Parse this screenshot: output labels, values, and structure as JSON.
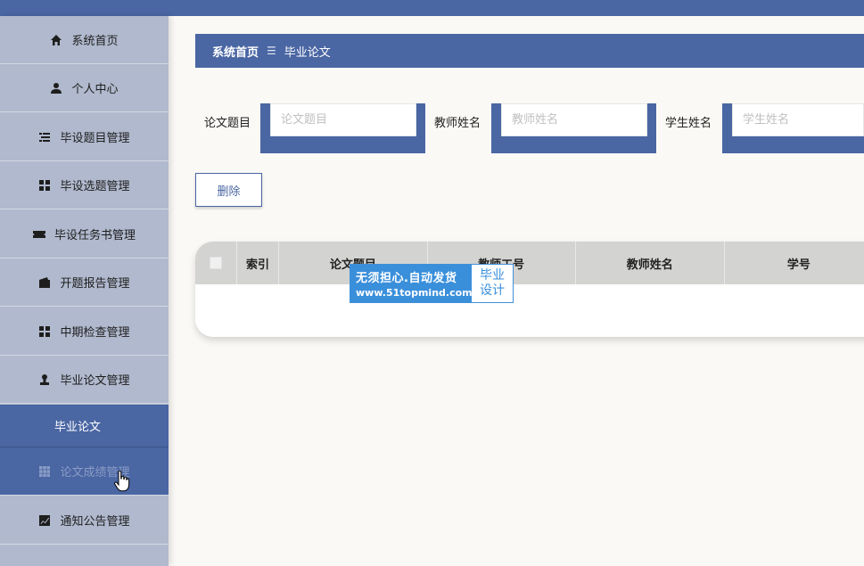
{
  "sidebar": {
    "items": [
      {
        "label": "系统首页",
        "icon": "home-icon"
      },
      {
        "label": "个人中心",
        "icon": "user-icon"
      },
      {
        "label": "毕设题目管理",
        "icon": "list-icon"
      },
      {
        "label": "毕设选题管理",
        "icon": "grid-icon"
      },
      {
        "label": "毕设任务书管理",
        "icon": "ticket-icon"
      },
      {
        "label": "开题报告管理",
        "icon": "wallet-icon"
      },
      {
        "label": "中期检查管理",
        "icon": "grid-icon"
      },
      {
        "label": "毕业论文管理",
        "icon": "stamp-icon"
      },
      {
        "label": "毕业论文",
        "icon": ""
      },
      {
        "label": "论文成绩管理",
        "icon": "table-icon"
      },
      {
        "label": "通知公告管理",
        "icon": "chart-icon"
      }
    ]
  },
  "breadcrumb": {
    "home": "系统首页",
    "separator": "☰",
    "current": "毕业论文"
  },
  "search": {
    "fields": [
      {
        "label": "论文题目",
        "placeholder": "论文题目"
      },
      {
        "label": "教师姓名",
        "placeholder": "教师姓名"
      },
      {
        "label": "学生姓名",
        "placeholder": "学生姓名"
      }
    ]
  },
  "toolbar": {
    "delete_label": "删除"
  },
  "table": {
    "columns": [
      "索引",
      "论文题目",
      "教师工号",
      "教师姓名",
      "学号"
    ]
  },
  "watermark": {
    "line1": "无须担心.自动发货",
    "line2": "www.51topmind.com",
    "right1": "毕业",
    "right2": "设计"
  },
  "colors": {
    "primary": "#4a66a3",
    "sidebar_bg": "#b0b9cd",
    "header_bg": "#d3d3d1",
    "watermark_blue": "#3a8fdb"
  }
}
